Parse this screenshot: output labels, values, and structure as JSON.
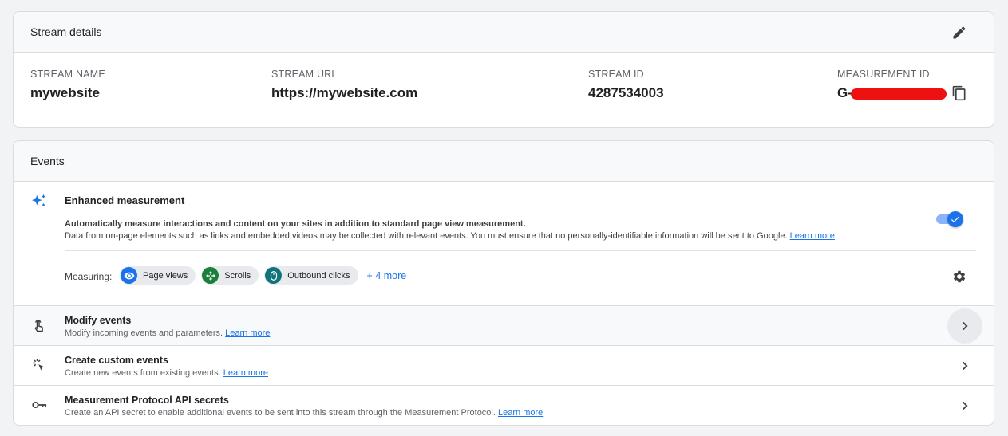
{
  "stream_details": {
    "title": "Stream details",
    "fields": [
      {
        "label": "STREAM NAME",
        "value": "mywebsite"
      },
      {
        "label": "STREAM URL",
        "value": "https://mywebsite.com"
      },
      {
        "label": "STREAM ID",
        "value": "4287534003"
      },
      {
        "label": "MEASUREMENT ID",
        "value": "G-"
      }
    ],
    "edit_icon": "pencil-icon",
    "copy_icon": "copy-icon"
  },
  "events": {
    "title": "Events",
    "enhanced": {
      "title": "Enhanced measurement",
      "desc1": "Automatically measure interactions and content on your sites in addition to standard page view measurement.",
      "desc2": "Data from on-page elements such as links and embedded videos may be collected with relevant events. You must ensure that no personally-identifiable information will be sent to Google.",
      "learn_more": "Learn more",
      "toggle_on": true,
      "measuring_label": "Measuring:",
      "chips": [
        {
          "label": "Page views",
          "color": "#1a73e8",
          "icon": "eye-icon"
        },
        {
          "label": "Scrolls",
          "color": "#188038",
          "icon": "scroll-icon"
        },
        {
          "label": "Outbound clicks",
          "color": "#12747b",
          "icon": "mouse-icon"
        }
      ],
      "more": "+ 4 more"
    },
    "rows": [
      {
        "title": "Modify events",
        "sub": "Modify incoming events and parameters.",
        "link": "Learn more",
        "icon": "touch-icon"
      },
      {
        "title": "Create custom events",
        "sub": "Create new events from existing events.",
        "link": "Learn more",
        "icon": "click-sparkle-icon"
      },
      {
        "title": "Measurement Protocol API secrets",
        "sub": "Create an API secret to enable additional events to be sent into this stream through the Measurement Protocol.",
        "link": "Learn more",
        "icon": "key-icon"
      }
    ]
  },
  "colors": {
    "accent": "#1a73e8",
    "redaction": "#ee1111"
  }
}
